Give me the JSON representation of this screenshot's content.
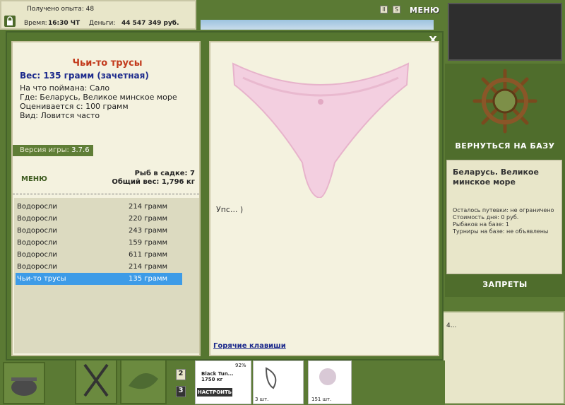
{
  "status": {
    "exp_label": "Получено опыта:",
    "exp_value": "48",
    "time_label": "Время:",
    "time_value": "16:30 ЧТ",
    "money_label": "Деньги:",
    "money_value": "44 547 349 руб."
  },
  "top_menu_label": "МЕНЮ",
  "top_icons": [
    "pause-icon",
    "sound-icon"
  ],
  "top_icon_glyphs": [
    "II",
    "S"
  ],
  "right": {
    "return_label": "ВЕРНУТЬСЯ НА БАЗУ",
    "location_title": "Беларусь. Великое минское море",
    "trip_left": "Осталось путевки: не ограничено",
    "day_cost": "Стоимость дня: 0 руб.",
    "fishermen": "Рыбаков на базе: 1",
    "tournaments": "Турниры на базе: не объявлены",
    "bans_label": "ЗАПРЕТЫ",
    "side_text": "4..."
  },
  "dialog": {
    "close_label": "X",
    "fish_name": "Чьи-то трусы",
    "fish_weight": "Вес: 135 грамм (зачетная)",
    "caught_on": "На что поймана: Сало",
    "where": "Где: Беларусь, Великое минское море",
    "valued_from": "Оценивается с: 100 грамм",
    "kind": "Вид: Ловится часто",
    "version_label": "Версия игры:",
    "version_value": "3.7.6",
    "menu_label": "МЕНЮ",
    "fish_in_net": "Рыб в садке: 7",
    "total_weight": "Общий вес: 1,796 кг",
    "catch_list": [
      {
        "name": "Водоросли",
        "weight": "214 грамм"
      },
      {
        "name": "Водоросли",
        "weight": "220 грамм"
      },
      {
        "name": "Водоросли",
        "weight": "243 грамм"
      },
      {
        "name": "Водоросли",
        "weight": "159 грамм"
      },
      {
        "name": "Водоросли",
        "weight": "611 грамм"
      },
      {
        "name": "Водоросли",
        "weight": "214 грамм"
      },
      {
        "name": "Чьи-то трусы",
        "weight": "135 грамм",
        "selected": true
      }
    ],
    "oops_text": "Упс... )",
    "hotkeys_label": "Горячие клавиши"
  },
  "bottom": {
    "slot_numbers": [
      "2",
      "3"
    ],
    "rod_name": "Black Tun...",
    "rod_weight": "1750 кг",
    "rod_percent": "92%",
    "setup_label": "НАСТРОИТЬ",
    "item1_count": "3 шт.",
    "item2_count": "151 шт."
  },
  "colors": {
    "accent_green": "#5b7a34",
    "panel_cream": "#f4f2df",
    "fish_name_red": "#c23a1c",
    "weight_blue": "#1c2a8c",
    "selected_blue": "#3d9be7"
  }
}
